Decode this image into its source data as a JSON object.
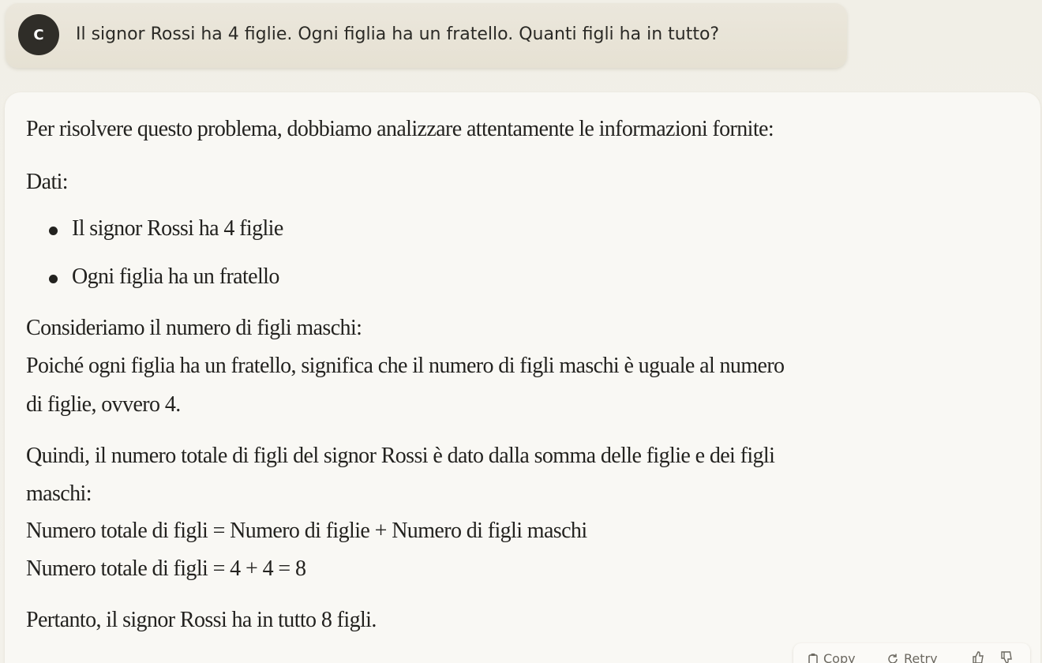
{
  "user_message": {
    "avatar_initial": "C",
    "text": "Il signor Rossi ha 4 figlie. Ogni figlia ha un fratello. Quanti figli ha in tutto?"
  },
  "reply": {
    "intro": "Per risolvere questo problema, dobbiamo analizzare attentamente le informazioni fornite:",
    "data_heading": "Dati:",
    "bullets": [
      "Il signor Rossi ha 4 figlie",
      "Ogni figlia ha un fratello"
    ],
    "consider": "Consideriamo il numero di figli maschi:",
    "since_line1": "Poiché ogni figlia ha un fratello, significa che il numero di figli maschi è uguale al numero",
    "since_line2": "di figlie, ovvero 4.",
    "therefore_line1": "Quindi, il numero totale di figli del signor Rossi è dato dalla somma delle figlie e dei figli",
    "therefore_line2": "maschi:",
    "formula1": "Numero totale di figli = Numero di figlie + Numero di figli maschi",
    "formula2": "Numero totale di figli = 4 + 4 = 8",
    "conclusion": "Pertanto, il signor Rossi ha in tutto 8 figli."
  },
  "actions": {
    "copy_label": "Copy",
    "retry_label": "Retry"
  }
}
